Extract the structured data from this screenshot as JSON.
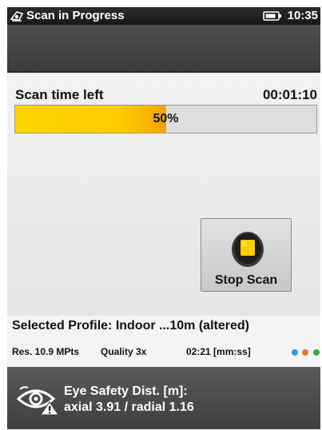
{
  "status_bar": {
    "title": "Scan in Progress",
    "time": "10:35"
  },
  "scan": {
    "time_left_label": "Scan time left",
    "time_left_value": "00:01:10",
    "progress_fraction": 0.5,
    "progress_text": "50%"
  },
  "stop_button": {
    "label": "Stop Scan"
  },
  "profile": {
    "text": "Selected Profile: Indoor ...10m (altered)"
  },
  "stats": {
    "resolution": "Res. 10.9 MPts",
    "quality": "Quality 3x",
    "duration": "02:21 [mm:ss]",
    "indicator_colors": [
      "#2f9bd9",
      "#f0752d",
      "#3ea64a"
    ]
  },
  "safety": {
    "line1": "Eye Safety Dist. [m]:",
    "line2": "axial 3.91 / radial 1.16"
  },
  "colors": {
    "progress_accent": "#ffcc00",
    "stop_icon": "#ffcc00"
  }
}
